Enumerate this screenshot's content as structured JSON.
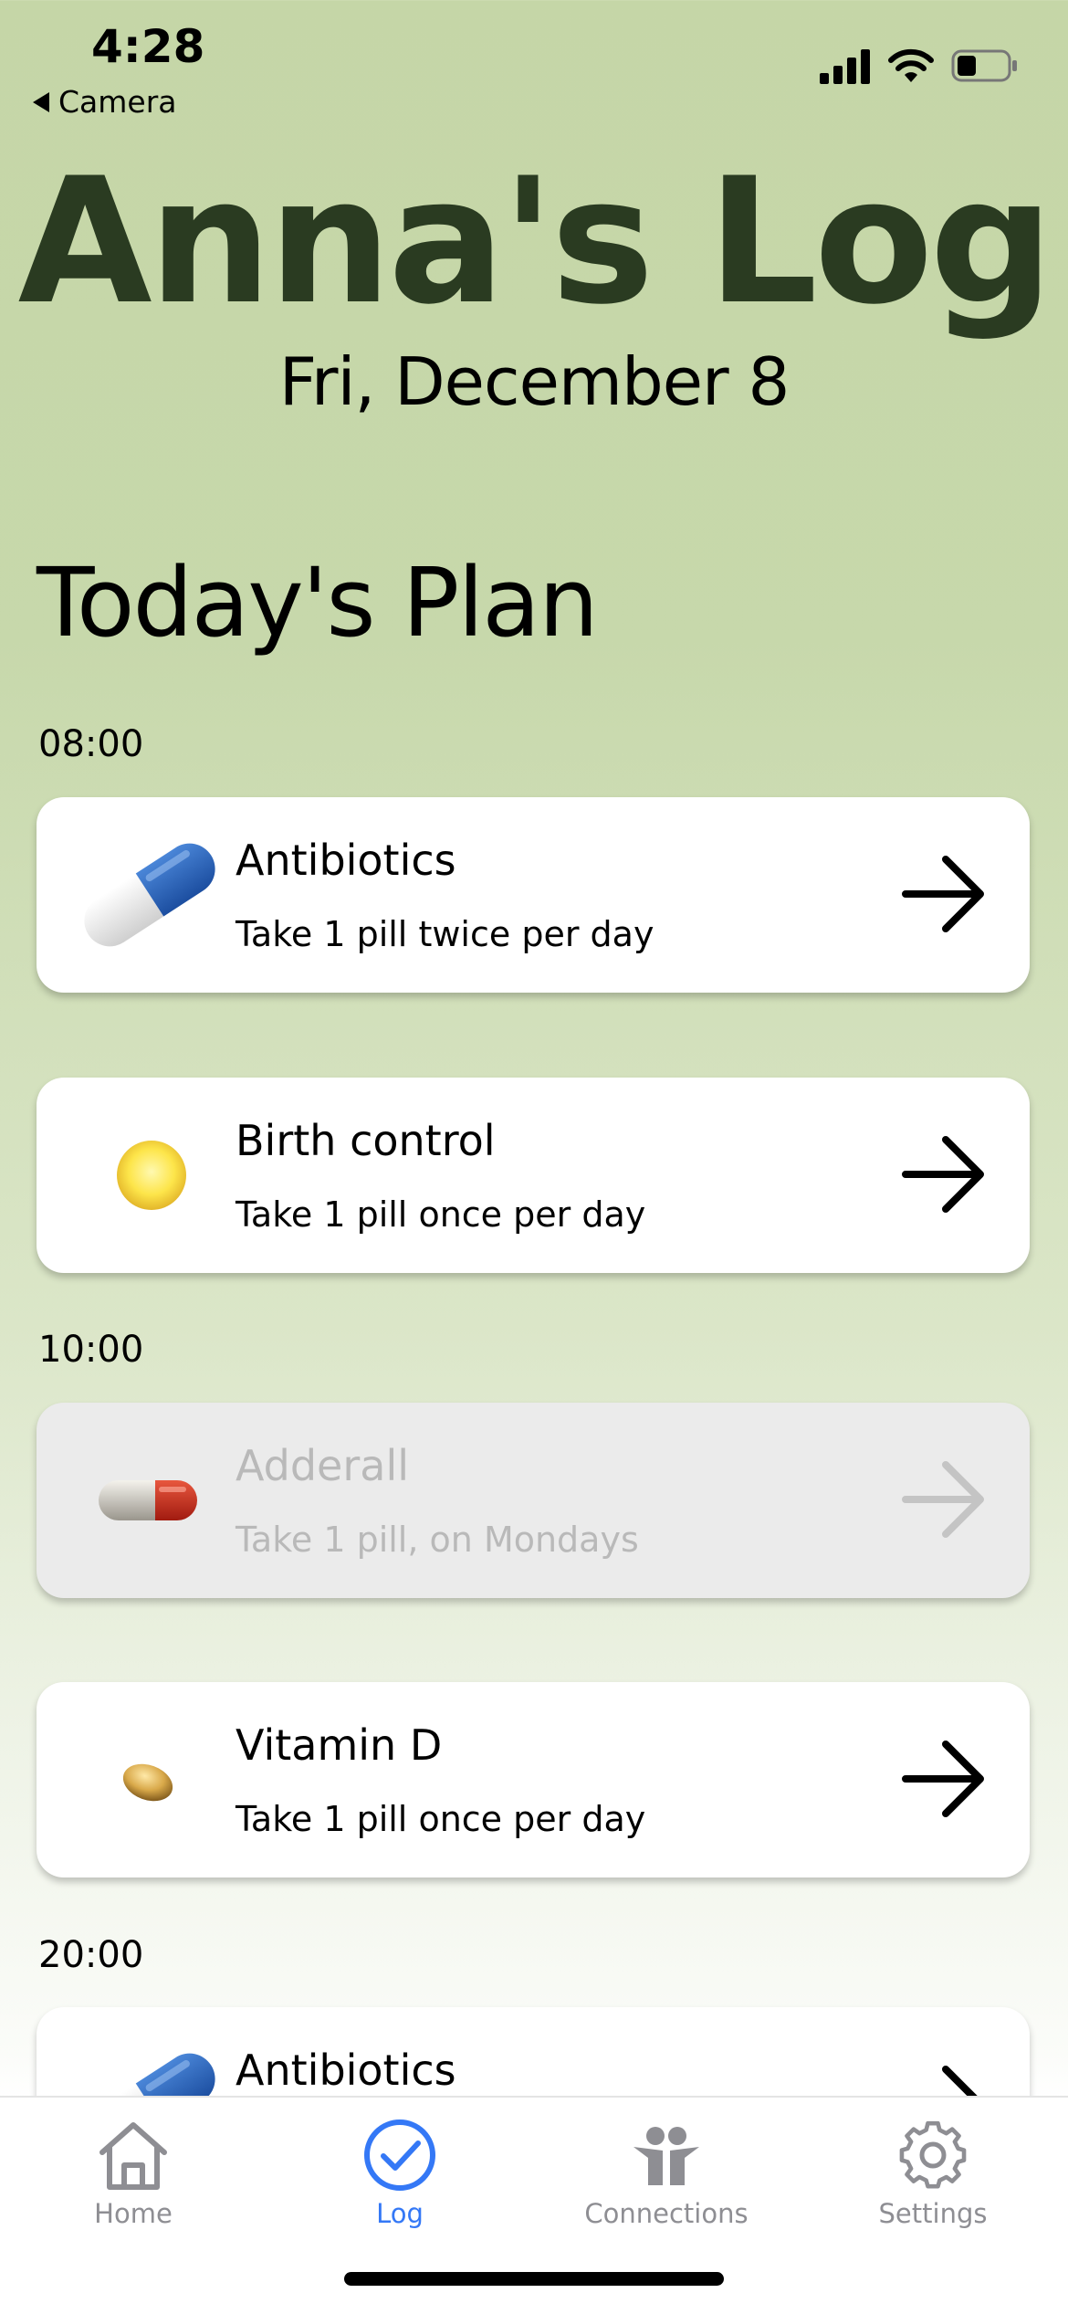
{
  "status_bar": {
    "time": "4:28",
    "back_label": "Camera"
  },
  "header": {
    "title": "Anna's Log",
    "date": "Fri, December 8"
  },
  "plan": {
    "section_title": "Today's Plan",
    "slots": [
      {
        "time": "08:00"
      },
      {
        "time": "10:00"
      },
      {
        "time": "20:00"
      }
    ],
    "items": [
      {
        "name": "Antibiotics",
        "dose": "Take 1 pill twice per day",
        "pill": "blue-white-capsule",
        "enabled": true
      },
      {
        "name": "Birth control",
        "dose": "Take 1 pill once per day",
        "pill": "yellow-round-pill",
        "enabled": true
      },
      {
        "name": "Adderall",
        "dose": "Take 1 pill, on Mondays",
        "pill": "red-white-capsule",
        "enabled": false
      },
      {
        "name": "Vitamin D",
        "dose": "Take 1 pill once per day",
        "pill": "amber-softgel",
        "enabled": true
      },
      {
        "name": "Antibiotics",
        "pill": "blue-white-capsule",
        "enabled": true
      }
    ]
  },
  "tab_bar": {
    "tabs": [
      {
        "label": "Home",
        "icon": "house-icon",
        "active": false
      },
      {
        "label": "Log",
        "icon": "checkmark-circle-icon",
        "active": true
      },
      {
        "label": "Connections",
        "icon": "people-icon",
        "active": false
      },
      {
        "label": "Settings",
        "icon": "gear-icon",
        "active": false
      }
    ]
  },
  "colors": {
    "title": "#2a3b21",
    "background_top": "#c5d6a7",
    "accent": "#3478f6",
    "inactive_tab": "#8e8e93",
    "disabled_card": "#ebebeb"
  }
}
